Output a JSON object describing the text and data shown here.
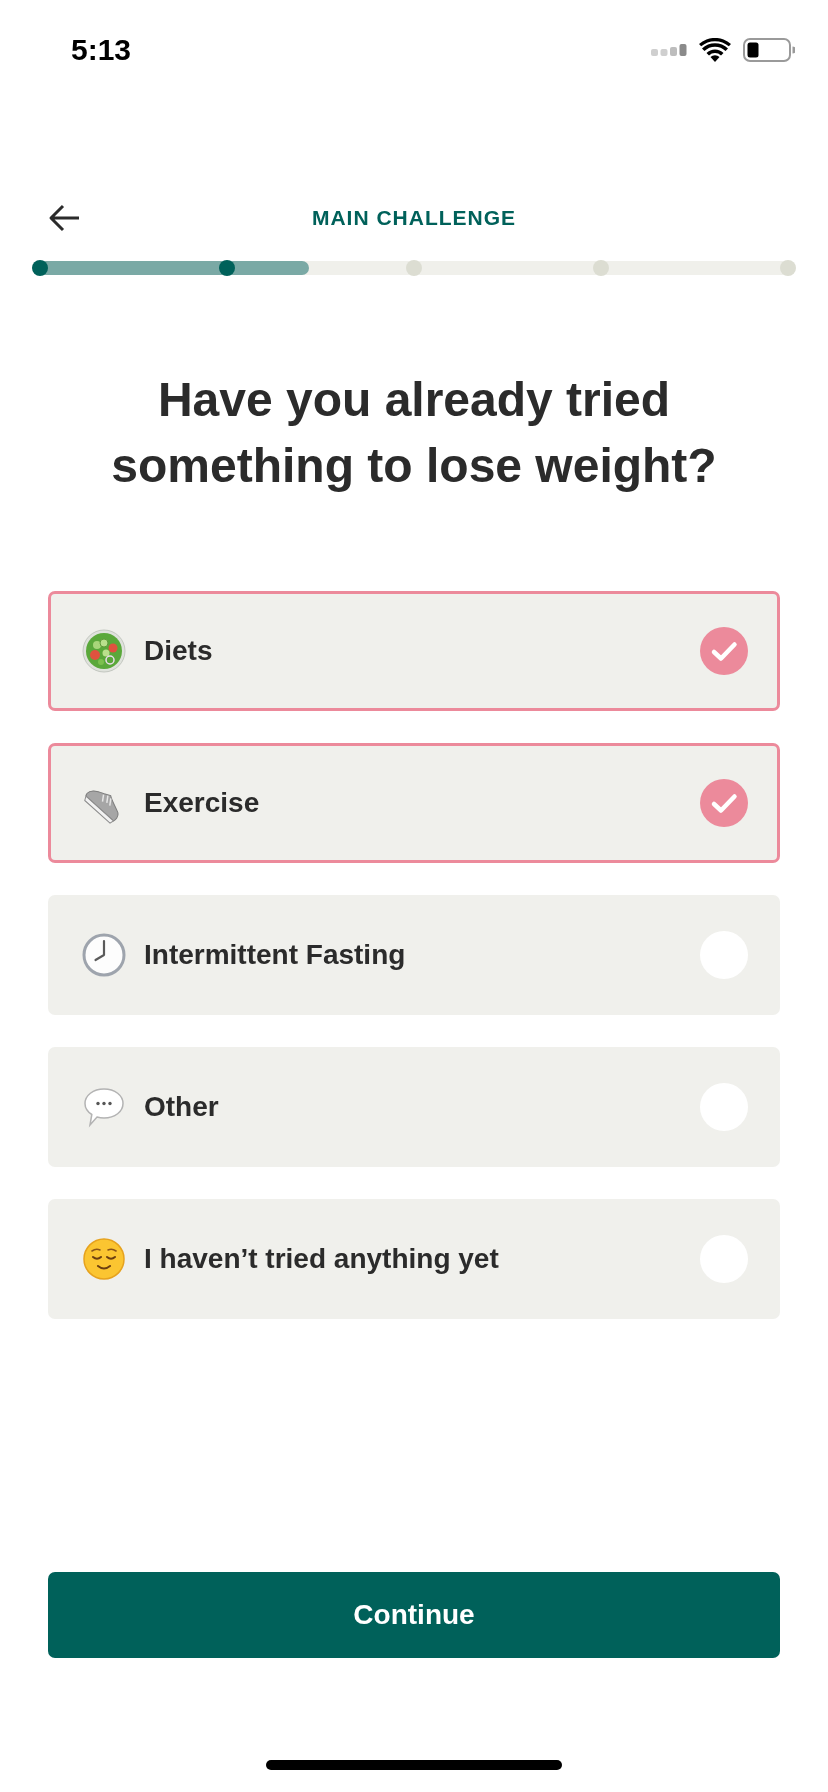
{
  "status_bar": {
    "time": "5:13"
  },
  "header": {
    "title": "MAIN CHALLENGE"
  },
  "progress": {
    "level": 0.362,
    "steps": [
      {
        "reached": true
      },
      {
        "reached": true
      },
      {
        "reached": false
      },
      {
        "reached": false
      },
      {
        "reached": false
      }
    ]
  },
  "question": "Have you already tried something to lose weight?",
  "options": [
    {
      "kind": "salad",
      "label": "Diets",
      "selected": true
    },
    {
      "kind": "sneaker",
      "label": "Exercise",
      "selected": true
    },
    {
      "kind": "clock",
      "label": "Intermittent Fasting",
      "selected": false
    },
    {
      "kind": "speech",
      "label": "Other",
      "selected": false
    },
    {
      "kind": "face",
      "label": "I haven’t tried anything yet",
      "selected": false
    }
  ],
  "button": {
    "label": "Continue"
  }
}
